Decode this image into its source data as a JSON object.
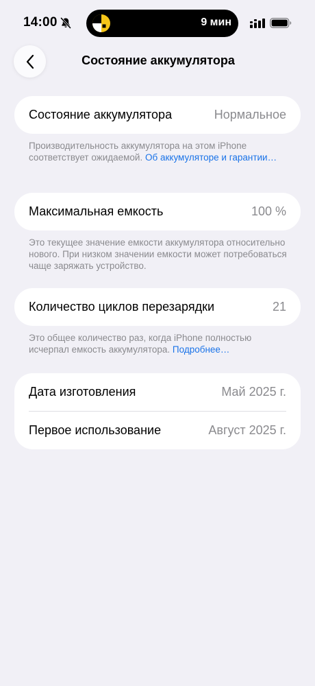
{
  "status_bar": {
    "time": "14:00",
    "island_text": "9 мин"
  },
  "nav": {
    "title": "Состояние аккумулятора"
  },
  "sections": {
    "health": {
      "label": "Состояние аккумулятора",
      "value": "Нормальное",
      "footnote_text": "Производительность аккумулятора на этом iPhone соответствует ожидаемой. ",
      "footnote_link": "Об аккумуляторе и гаран­тии…"
    },
    "capacity": {
      "label": "Максимальная емкость",
      "value": "100 %",
      "footnote_text": "Это текущее значение емкости аккумулятора относительно нового. При низком значении емкости может потребоваться чаще заряжать устройство."
    },
    "cycles": {
      "label": "Количество циклов перезарядки",
      "value": "21",
      "footnote_text": "Это общее количество раз, когда iPhone полностью исчерпал емкость аккумулятора. ",
      "footnote_link": "Подробнее…"
    },
    "dates": {
      "manufacture_label": "Дата изготовления",
      "manufacture_value": "Май 2025 г.",
      "first_use_label": "Первое использование",
      "first_use_value": "Август 2025 г."
    }
  },
  "colors": {
    "background": "#f1f0f6",
    "card": "#ffffff",
    "secondary_text": "#8a8a8e",
    "link": "#1a73e8",
    "island_accent": "#f5c518"
  },
  "icons": {
    "bell": "bell-slash-icon",
    "app": "yandex-go-icon",
    "signal": "cellular-signal-icon",
    "battery": "battery-icon",
    "back": "chevron-left-icon"
  }
}
